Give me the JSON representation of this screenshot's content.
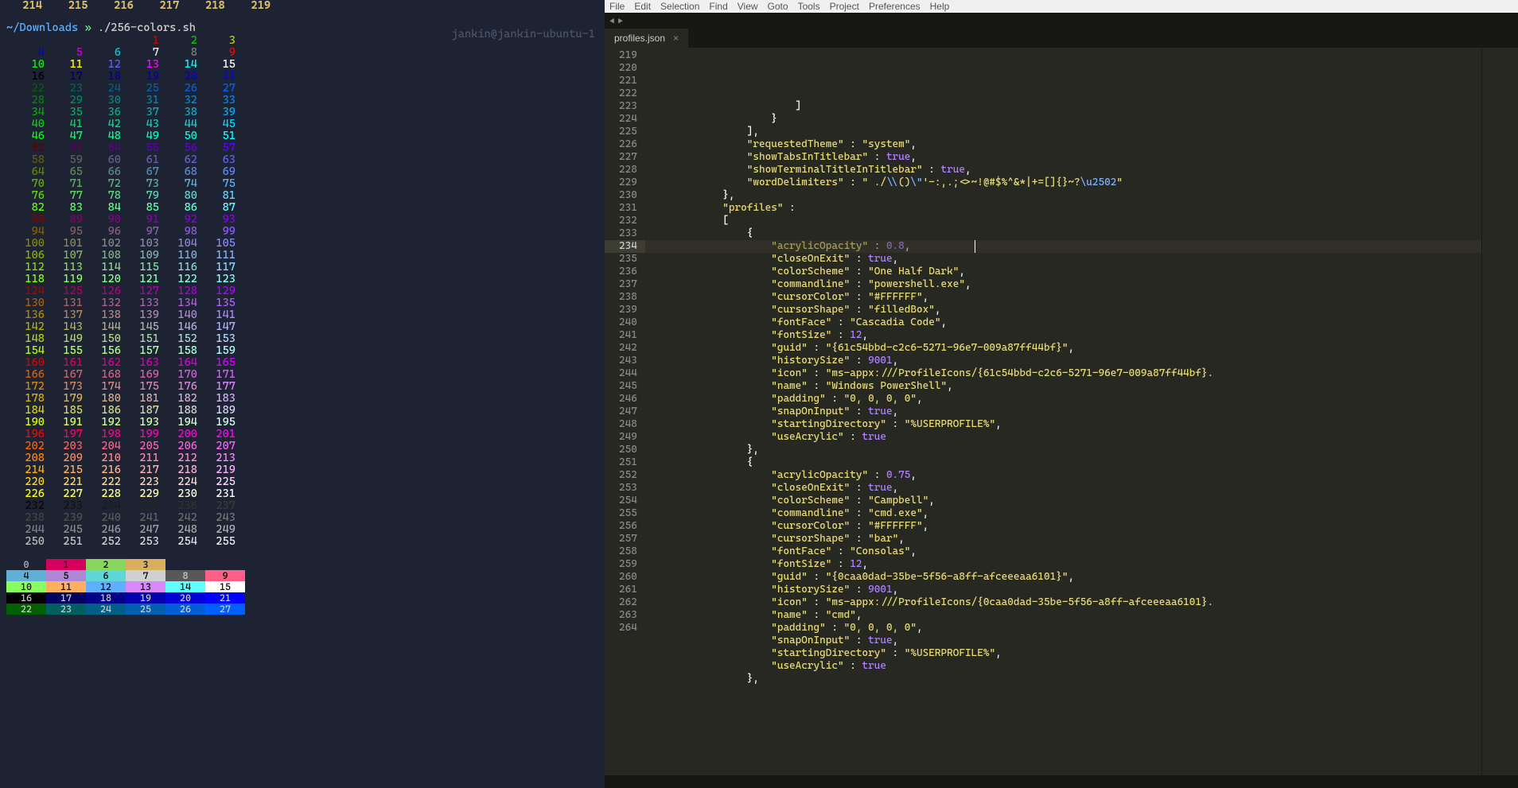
{
  "terminal": {
    "header_numbers": [
      "214",
      "215",
      "216",
      "217",
      "218",
      "219"
    ],
    "prompt_path": "~/Downloads",
    "prompt_symbol": "»",
    "command": "./256-colors.sh",
    "userhost": "jankin@jankin-ubuntu-1",
    "palette_bg_rows": [
      [
        "0",
        "1",
        "2",
        "3",
        "",
        "",
        "",
        ""
      ],
      [
        "4",
        "5",
        "6",
        "7",
        "8",
        "9",
        "",
        ""
      ],
      [
        "10",
        "11",
        "12",
        "13",
        "14",
        "15",
        "",
        ""
      ],
      [
        "16",
        "17",
        "18",
        "19",
        "20",
        "21",
        ""
      ],
      [
        "22",
        "23",
        "24",
        "25",
        "26",
        "27",
        ""
      ]
    ],
    "bg_colors": [
      [
        "",
        "#d7005f",
        "#87d75f",
        "#d7af5f",
        "",
        "",
        "",
        ""
      ],
      [
        "#5fafd7",
        "#af87d7",
        "#5fd7d7",
        "#d0d0d0",
        "#585858",
        "#ff5f87",
        "",
        ""
      ],
      [
        "#87ff5f",
        "#ffaf5f",
        "#5fafff",
        "#d787ff",
        "#5fffff",
        "#ffffff",
        "",
        ""
      ],
      [
        "#000000",
        "#00005f",
        "#000087",
        "#0000af",
        "#0000d7",
        "#0000ff",
        ""
      ],
      [
        "#005f00",
        "#005f5f",
        "#005f87",
        "#005faf",
        "#005fd7",
        "#005fff",
        ""
      ]
    ],
    "bg_fg": [
      [
        "#bbb",
        "#000",
        "#000",
        "#000",
        "",
        "",
        "",
        ""
      ],
      [
        "#000",
        "#000",
        "#000",
        "#000",
        "#ccc",
        "#000",
        "",
        ""
      ],
      [
        "#000",
        "#000",
        "#000",
        "#000",
        "#000",
        "#000",
        "",
        ""
      ],
      [
        "#ccc",
        "#ccc",
        "#ccc",
        "#ccc",
        "#ccc",
        "#ccc",
        ""
      ],
      [
        "#ccc",
        "#ccc",
        "#ccc",
        "#ccc",
        "#ccc",
        "#ccc",
        ""
      ]
    ]
  },
  "editor": {
    "menus": [
      "File",
      "Edit",
      "Selection",
      "Find",
      "View",
      "Goto",
      "Tools",
      "Project",
      "Preferences",
      "Help"
    ],
    "tab_title": "profiles.json",
    "line_start": 219,
    "highlight_line": 234,
    "cursor_line": 235,
    "lines": [
      {
        "ind": 24,
        "body": [
          {
            "t": "]",
            "c": "p"
          }
        ]
      },
      {
        "ind": 20,
        "body": [
          {
            "t": "}",
            "c": "p"
          }
        ]
      },
      {
        "ind": 16,
        "body": [
          {
            "t": "],",
            "c": "p"
          }
        ]
      },
      {
        "ind": 16,
        "body": [
          {
            "t": "\"requestedTheme\"",
            "c": "k"
          },
          {
            "t": " : ",
            "c": "p"
          },
          {
            "t": "\"system\"",
            "c": "k"
          },
          {
            "t": ",",
            "c": "p"
          }
        ]
      },
      {
        "ind": 16,
        "body": [
          {
            "t": "\"showTabsInTitlebar\"",
            "c": "k"
          },
          {
            "t": " : ",
            "c": "p"
          },
          {
            "t": "true",
            "c": "b"
          },
          {
            "t": ",",
            "c": "p"
          }
        ]
      },
      {
        "ind": 16,
        "body": [
          {
            "t": "\"showTerminalTitleInTitlebar\"",
            "c": "k"
          },
          {
            "t": " : ",
            "c": "p"
          },
          {
            "t": "true",
            "c": "b"
          },
          {
            "t": ",",
            "c": "p"
          }
        ]
      },
      {
        "ind": 16,
        "body": [
          {
            "t": "\"wordDelimiters\"",
            "c": "k"
          },
          {
            "t": " : ",
            "c": "p"
          },
          {
            "t": "\" ./",
            "c": "k"
          },
          {
            "t": "\\\\",
            "c": "e"
          },
          {
            "t": "()",
            "c": "k"
          },
          {
            "t": "\\\"",
            "c": "e"
          },
          {
            "t": "'-:,.;<>~!@#$%^&*|+=[]{}~?",
            "c": "k"
          },
          {
            "t": "\\u2502",
            "c": "e"
          },
          {
            "t": "\"",
            "c": "k"
          }
        ]
      },
      {
        "ind": 12,
        "body": [
          {
            "t": "},",
            "c": "p"
          }
        ]
      },
      {
        "ind": 12,
        "body": [
          {
            "t": "\"profiles\"",
            "c": "k"
          },
          {
            "t": " :",
            "c": "p"
          }
        ]
      },
      {
        "ind": 12,
        "body": [
          {
            "t": "[",
            "c": "p"
          }
        ]
      },
      {
        "ind": 16,
        "body": [
          {
            "t": "{",
            "c": "p"
          }
        ]
      },
      {
        "ind": 20,
        "body": [
          {
            "t": "\"acrylicOpacity\"",
            "c": "k"
          },
          {
            "t": " : ",
            "c": "p"
          },
          {
            "t": "0.8",
            "c": "n"
          },
          {
            "t": ",",
            "c": "p"
          }
        ]
      },
      {
        "ind": 20,
        "body": [
          {
            "t": "\"closeOnExit\"",
            "c": "k"
          },
          {
            "t": " : ",
            "c": "p"
          },
          {
            "t": "true",
            "c": "b"
          },
          {
            "t": ",",
            "c": "p"
          }
        ]
      },
      {
        "ind": 20,
        "body": [
          {
            "t": "\"colorScheme\"",
            "c": "k"
          },
          {
            "t": " : ",
            "c": "p"
          },
          {
            "t": "\"One Half Dark\"",
            "c": "k"
          },
          {
            "t": ",",
            "c": "p"
          }
        ]
      },
      {
        "ind": 20,
        "body": [
          {
            "t": "\"commandline\"",
            "c": "k"
          },
          {
            "t": " : ",
            "c": "p"
          },
          {
            "t": "\"powershell.exe\"",
            "c": "k"
          },
          {
            "t": ",",
            "c": "p"
          }
        ]
      },
      {
        "ind": 20,
        "body": [
          {
            "t": "\"cursorColor\"",
            "c": "k"
          },
          {
            "t": " : ",
            "c": "p"
          },
          {
            "t": "\"#FFFFFF\"",
            "c": "k"
          },
          {
            "t": ",",
            "c": "p"
          }
        ]
      },
      {
        "ind": 20,
        "body": [
          {
            "t": "\"cursorShape\"",
            "c": "k"
          },
          {
            "t": " : ",
            "c": "p"
          },
          {
            "t": "\"filledBox\"",
            "c": "k"
          },
          {
            "t": ",",
            "c": "p"
          }
        ]
      },
      {
        "ind": 20,
        "body": [
          {
            "t": "\"fontFace\"",
            "c": "k"
          },
          {
            "t": " : ",
            "c": "p"
          },
          {
            "t": "\"Cascadia Code\"",
            "c": "k"
          },
          {
            "t": ",",
            "c": "p"
          }
        ]
      },
      {
        "ind": 20,
        "body": [
          {
            "t": "\"fontSize\"",
            "c": "k"
          },
          {
            "t": " : ",
            "c": "p"
          },
          {
            "t": "12",
            "c": "n"
          },
          {
            "t": ",",
            "c": "p"
          }
        ]
      },
      {
        "ind": 20,
        "body": [
          {
            "t": "\"guid\"",
            "c": "k"
          },
          {
            "t": " : ",
            "c": "p"
          },
          {
            "t": "\"{61c54bbd-c2c6-5271-96e7-009a87ff44bf}\"",
            "c": "k"
          },
          {
            "t": ",",
            "c": "p"
          }
        ]
      },
      {
        "ind": 20,
        "body": [
          {
            "t": "\"historySize\"",
            "c": "k"
          },
          {
            "t": " : ",
            "c": "p"
          },
          {
            "t": "9001",
            "c": "n"
          },
          {
            "t": ",",
            "c": "p"
          }
        ]
      },
      {
        "ind": 20,
        "body": [
          {
            "t": "\"icon\"",
            "c": "k"
          },
          {
            "t": " : ",
            "c": "p"
          },
          {
            "t": "\"ms-appx:///ProfileIcons/{61c54bbd-c2c6-5271-96e7-009a87ff44bf}.",
            "c": "k"
          }
        ]
      },
      {
        "ind": 20,
        "body": [
          {
            "t": "\"name\"",
            "c": "k"
          },
          {
            "t": " : ",
            "c": "p"
          },
          {
            "t": "\"Windows PowerShell\"",
            "c": "k"
          },
          {
            "t": ",",
            "c": "p"
          }
        ]
      },
      {
        "ind": 20,
        "body": [
          {
            "t": "\"padding\"",
            "c": "k"
          },
          {
            "t": " : ",
            "c": "p"
          },
          {
            "t": "\"0, 0, 0, 0\"",
            "c": "k"
          },
          {
            "t": ",",
            "c": "p"
          }
        ]
      },
      {
        "ind": 20,
        "body": [
          {
            "t": "\"snapOnInput\"",
            "c": "k"
          },
          {
            "t": " : ",
            "c": "p"
          },
          {
            "t": "true",
            "c": "b"
          },
          {
            "t": ",",
            "c": "p"
          }
        ]
      },
      {
        "ind": 20,
        "body": [
          {
            "t": "\"startingDirectory\"",
            "c": "k"
          },
          {
            "t": " : ",
            "c": "p"
          },
          {
            "t": "\"%USERPROFILE%\"",
            "c": "k"
          },
          {
            "t": ",",
            "c": "p"
          }
        ]
      },
      {
        "ind": 20,
        "body": [
          {
            "t": "\"useAcrylic\"",
            "c": "k"
          },
          {
            "t": " : ",
            "c": "p"
          },
          {
            "t": "true",
            "c": "b"
          }
        ]
      },
      {
        "ind": 16,
        "body": [
          {
            "t": "},",
            "c": "p"
          }
        ]
      },
      {
        "ind": 16,
        "body": [
          {
            "t": "{",
            "c": "p"
          }
        ]
      },
      {
        "ind": 20,
        "body": [
          {
            "t": "\"acrylicOpacity\"",
            "c": "k"
          },
          {
            "t": " : ",
            "c": "p"
          },
          {
            "t": "0.75",
            "c": "n"
          },
          {
            "t": ",",
            "c": "p"
          }
        ]
      },
      {
        "ind": 20,
        "body": [
          {
            "t": "\"closeOnExit\"",
            "c": "k"
          },
          {
            "t": " : ",
            "c": "p"
          },
          {
            "t": "true",
            "c": "b"
          },
          {
            "t": ",",
            "c": "p"
          }
        ]
      },
      {
        "ind": 20,
        "body": [
          {
            "t": "\"colorScheme\"",
            "c": "k"
          },
          {
            "t": " : ",
            "c": "p"
          },
          {
            "t": "\"Campbell\"",
            "c": "k"
          },
          {
            "t": ",",
            "c": "p"
          }
        ]
      },
      {
        "ind": 20,
        "body": [
          {
            "t": "\"commandline\"",
            "c": "k"
          },
          {
            "t": " : ",
            "c": "p"
          },
          {
            "t": "\"cmd.exe\"",
            "c": "k"
          },
          {
            "t": ",",
            "c": "p"
          }
        ]
      },
      {
        "ind": 20,
        "body": [
          {
            "t": "\"cursorColor\"",
            "c": "k"
          },
          {
            "t": " : ",
            "c": "p"
          },
          {
            "t": "\"#FFFFFF\"",
            "c": "k"
          },
          {
            "t": ",",
            "c": "p"
          }
        ]
      },
      {
        "ind": 20,
        "body": [
          {
            "t": "\"cursorShape\"",
            "c": "k"
          },
          {
            "t": " : ",
            "c": "p"
          },
          {
            "t": "\"bar\"",
            "c": "k"
          },
          {
            "t": ",",
            "c": "p"
          }
        ]
      },
      {
        "ind": 20,
        "body": [
          {
            "t": "\"fontFace\"",
            "c": "k"
          },
          {
            "t": " : ",
            "c": "p"
          },
          {
            "t": "\"Consolas\"",
            "c": "k"
          },
          {
            "t": ",",
            "c": "p"
          }
        ]
      },
      {
        "ind": 20,
        "body": [
          {
            "t": "\"fontSize\"",
            "c": "k"
          },
          {
            "t": " : ",
            "c": "p"
          },
          {
            "t": "12",
            "c": "n"
          },
          {
            "t": ",",
            "c": "p"
          }
        ]
      },
      {
        "ind": 20,
        "body": [
          {
            "t": "\"guid\"",
            "c": "k"
          },
          {
            "t": " : ",
            "c": "p"
          },
          {
            "t": "\"{0caa0dad-35be-5f56-a8ff-afceeeaa6101}\"",
            "c": "k"
          },
          {
            "t": ",",
            "c": "p"
          }
        ]
      },
      {
        "ind": 20,
        "body": [
          {
            "t": "\"historySize\"",
            "c": "k"
          },
          {
            "t": " : ",
            "c": "p"
          },
          {
            "t": "9001",
            "c": "n"
          },
          {
            "t": ",",
            "c": "p"
          }
        ]
      },
      {
        "ind": 20,
        "body": [
          {
            "t": "\"icon\"",
            "c": "k"
          },
          {
            "t": " : ",
            "c": "p"
          },
          {
            "t": "\"ms-appx:///ProfileIcons/{0caa0dad-35be-5f56-a8ff-afceeeaa6101}.",
            "c": "k"
          }
        ]
      },
      {
        "ind": 20,
        "body": [
          {
            "t": "\"name\"",
            "c": "k"
          },
          {
            "t": " : ",
            "c": "p"
          },
          {
            "t": "\"cmd\"",
            "c": "k"
          },
          {
            "t": ",",
            "c": "p"
          }
        ]
      },
      {
        "ind": 20,
        "body": [
          {
            "t": "\"padding\"",
            "c": "k"
          },
          {
            "t": " : ",
            "c": "p"
          },
          {
            "t": "\"0, 0, 0, 0\"",
            "c": "k"
          },
          {
            "t": ",",
            "c": "p"
          }
        ]
      },
      {
        "ind": 20,
        "body": [
          {
            "t": "\"snapOnInput\"",
            "c": "k"
          },
          {
            "t": " : ",
            "c": "p"
          },
          {
            "t": "true",
            "c": "b"
          },
          {
            "t": ",",
            "c": "p"
          }
        ]
      },
      {
        "ind": 20,
        "body": [
          {
            "t": "\"startingDirectory\"",
            "c": "k"
          },
          {
            "t": " : ",
            "c": "p"
          },
          {
            "t": "\"%USERPROFILE%\"",
            "c": "k"
          },
          {
            "t": ",",
            "c": "p"
          }
        ]
      },
      {
        "ind": 20,
        "body": [
          {
            "t": "\"useAcrylic\"",
            "c": "k"
          },
          {
            "t": " : ",
            "c": "p"
          },
          {
            "t": "true",
            "c": "b"
          }
        ]
      },
      {
        "ind": 16,
        "body": [
          {
            "t": "},",
            "c": "p"
          }
        ]
      }
    ]
  }
}
